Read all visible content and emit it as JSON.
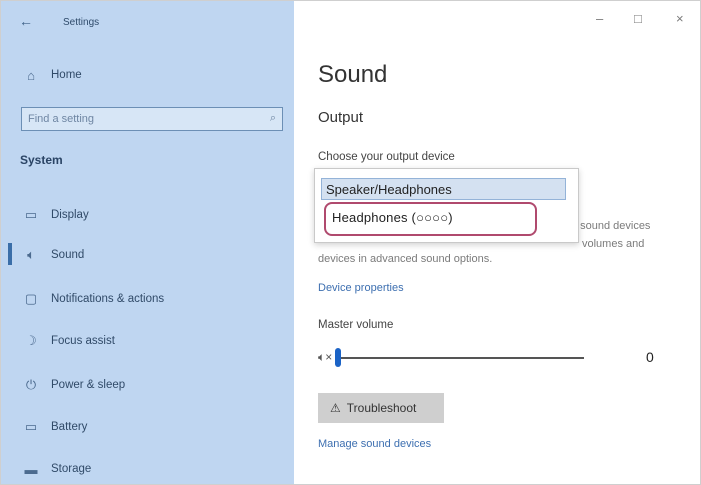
{
  "sidebar": {
    "window_title": "Settings",
    "home_label": "Home",
    "search_placeholder": "Find a setting",
    "section_label": "System",
    "items": [
      {
        "label": "Display",
        "icon": "display-icon"
      },
      {
        "label": "Sound",
        "icon": "speaker-icon"
      },
      {
        "label": "Notifications & actions",
        "icon": "notification-icon"
      },
      {
        "label": "Focus assist",
        "icon": "moon-icon"
      },
      {
        "label": "Power & sleep",
        "icon": "power-icon"
      },
      {
        "label": "Battery",
        "icon": "battery-icon"
      },
      {
        "label": "Storage",
        "icon": "storage-icon"
      }
    ],
    "selected": "Sound"
  },
  "window_controls": {
    "minimize": "–",
    "maximize": "□",
    "close": "×"
  },
  "main": {
    "title": "Sound",
    "section": "Output",
    "choose_label": "Choose your output device",
    "dropdown_options": [
      "Speaker/Headphones",
      "Headphones (○○○○)"
    ],
    "partial_text_1": "t sound devices",
    "partial_text_2": "volumes and",
    "partial_text_3": "devices in advanced sound options.",
    "device_properties_link": "Device properties",
    "master_volume_label": "Master volume",
    "volume_value": "0",
    "troubleshoot_label": "Troubleshoot",
    "manage_link": "Manage sound devices"
  },
  "colors": {
    "sidebar_bg": "#bfd6f1",
    "accent": "#1b63c6",
    "highlight_border": "#b04a6e"
  }
}
